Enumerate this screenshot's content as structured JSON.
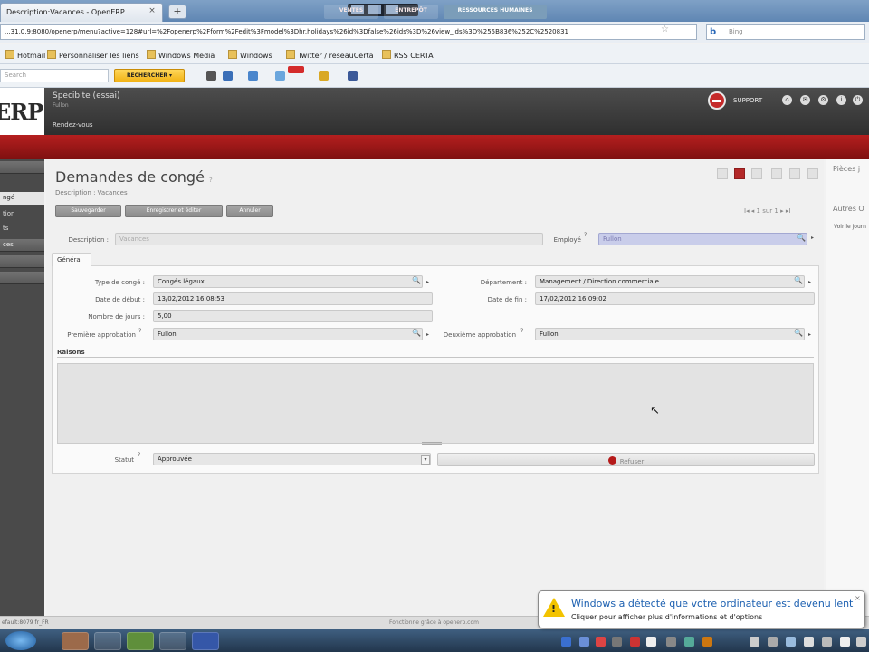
{
  "browser": {
    "tab_title": "Description:Vacances - OpenERP",
    "tab_close": "×",
    "new_tab": "+",
    "url": "...31.0.9:8080/openerp/menu?active=128#url=%2Fopenerp%2Fform%2Fedit%3Fmodel%3Dhr.holidays%26id%3Dfalse%26ids%3D%26view_ids%3D%255B836%252C%2520831",
    "search_placeholder": "Bing",
    "search_logo": "b"
  },
  "bookmarks": [
    {
      "label": "Hotmail"
    },
    {
      "label": "Personnaliser les liens"
    },
    {
      "label": "Windows Media"
    },
    {
      "label": "Windows"
    },
    {
      "label": "Twitter / reseauCerta"
    },
    {
      "label": "RSS CERTA"
    }
  ],
  "toolbar": {
    "search_placeholder": "Search",
    "search_button": "RECHERCHER ▾"
  },
  "erp": {
    "logo": "ERP",
    "company": "Specibite (essai)",
    "user": "Fullon",
    "menu_link": "Rendez-vous",
    "support": "SUPPORT",
    "menus": [
      {
        "label": "VENTES"
      },
      {
        "label": "ENTREPÔT"
      },
      {
        "label": "RESSOURCES HUMAINES"
      }
    ]
  },
  "sidebar": {
    "items": [
      {
        "label": ""
      },
      {
        "label": "ngé"
      },
      {
        "label": "tion"
      },
      {
        "label": "ts"
      },
      {
        "label": "ces"
      },
      {
        "label": ""
      },
      {
        "label": ""
      }
    ]
  },
  "form": {
    "title": "Demandes de congé",
    "title_help": "?",
    "breadcrumb": "Description : Vacances",
    "buttons": {
      "save": "Sauvegarder",
      "save_edit": "Enregistrer et éditer",
      "cancel": "Annuler"
    },
    "pager": "I◂ ◂ 1 sur 1 ▸ ▸I",
    "description_label": "Description :",
    "description_value": "Vacances",
    "employee_label": "Employé",
    "employee_value": "Fullon",
    "tab_general": "Général",
    "type_label": "Type de congé :",
    "type_value": "Congés légaux",
    "start_label": "Date de début :",
    "start_value": "13/02/2012 16:08:53",
    "days_label": "Nombre de jours :",
    "days_value": "5,00",
    "first_approval_label": "Première approbation",
    "first_approval_value": "Fullon",
    "department_label": "Département :",
    "department_value": "Management / Direction commerciale",
    "end_label": "Date de fin :",
    "end_value": "17/02/2012 16:09:02",
    "second_approval_label": "Deuxième approbation",
    "second_approval_value": "Fullon",
    "reason_label": "Raisons",
    "status_label": "Statut",
    "status_value": "Approuvée",
    "refuse_button": "Refuser"
  },
  "right_panel": {
    "attachments": "Pièces j",
    "other": "Autres O",
    "item": "Voir le journ"
  },
  "footer": {
    "left": "efault:8079   fr_FR",
    "center": "Fonctionne grâce à openerp.com"
  },
  "notification": {
    "title": "Windows a détecté que votre ordinateur est devenu lent",
    "text": "Cliquer pour afficher plus d'informations et d'options",
    "close": "×"
  },
  "colors": {
    "erp_red": "#b51f1f",
    "erp_dark": "#3a3a3a",
    "accent_blue": "#1b5fb0"
  }
}
